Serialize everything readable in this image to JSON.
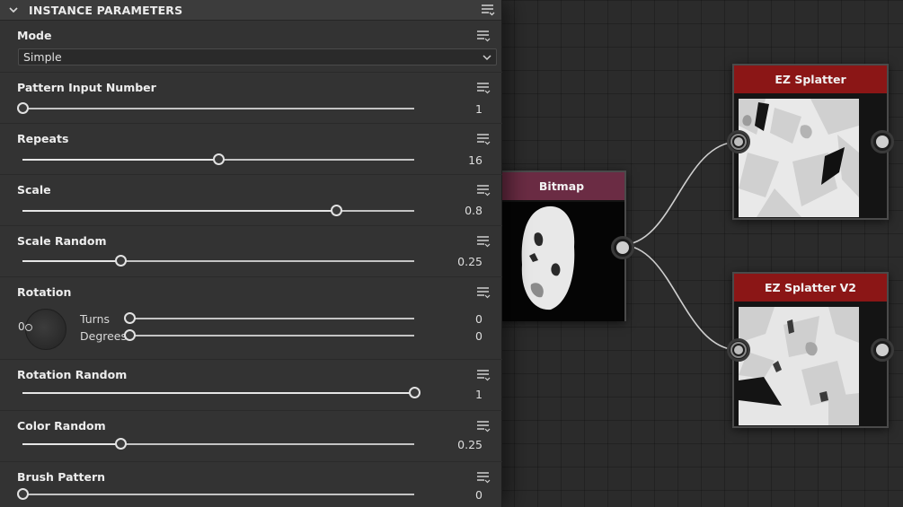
{
  "panel": {
    "title": "INSTANCE PARAMETERS",
    "mode": {
      "label": "Mode",
      "value": "Simple"
    },
    "params": {
      "pattern_input_number": {
        "label": "Pattern Input Number",
        "value": "1",
        "position": 0.0
      },
      "repeats": {
        "label": "Repeats",
        "value": "16",
        "position": 0.5
      },
      "scale": {
        "label": "Scale",
        "value": "0.8",
        "position": 0.8
      },
      "scale_random": {
        "label": "Scale Random",
        "value": "0.25",
        "position": 0.25
      },
      "rotation": {
        "label": "Rotation",
        "dial_value": "0",
        "turns": {
          "label": "Turns",
          "value": "0",
          "position": 0.0
        },
        "degrees": {
          "label": "Degrees",
          "value": "0",
          "position": 0.0
        }
      },
      "rotation_random": {
        "label": "Rotation Random",
        "value": "1",
        "position": 1.0
      },
      "color_random": {
        "label": "Color Random",
        "value": "0.25",
        "position": 0.25
      },
      "brush_pattern": {
        "label": "Brush Pattern",
        "value": "0",
        "position": 0.0
      }
    }
  },
  "graph": {
    "nodes": {
      "bitmap": {
        "title": "Bitmap",
        "color": "#6b2c44"
      },
      "splatter": {
        "title": "EZ Splatter",
        "color": "#8b1616"
      },
      "splatter_v2": {
        "title": "EZ Splatter V2",
        "color": "#8b1616"
      }
    }
  },
  "icons": {
    "collapse": "chevron-down-icon",
    "menu": "menu-icon",
    "dropdown": "dropdown-caret-icon"
  }
}
